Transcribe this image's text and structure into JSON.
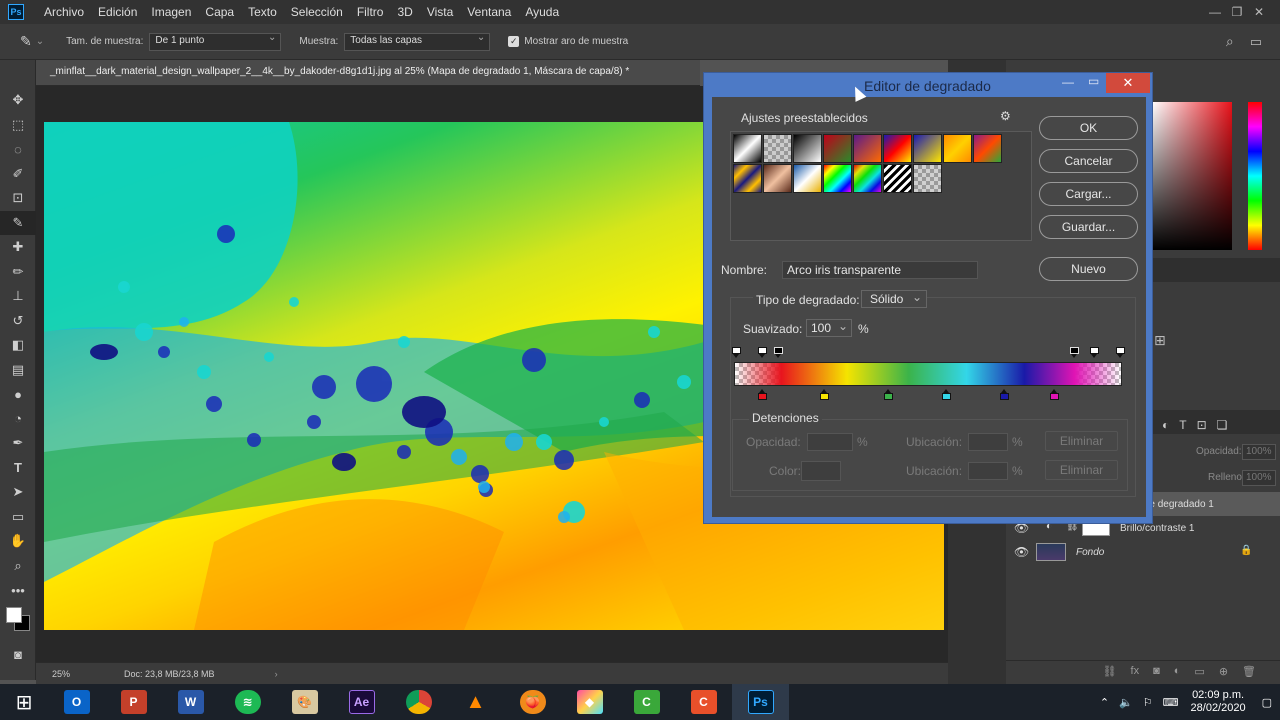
{
  "app": {
    "logo": "Ps"
  },
  "menu": [
    "Archivo",
    "Edición",
    "Imagen",
    "Capa",
    "Texto",
    "Selección",
    "Filtro",
    "3D",
    "Vista",
    "Ventana",
    "Ayuda"
  ],
  "options": {
    "sample_size_label": "Tam. de muestra:",
    "sample_size_value": "De 1 punto",
    "sample_label": "Muestra:",
    "sample_value": "Todas las capas",
    "show_ring_label": "Mostrar aro de muestra"
  },
  "document": {
    "tab_title": "_minflat__dark_material_design_wallpaper_2__4k__by_dakoder-d8g1d1j.jpg al 25% (Mapa de degradado 1, Máscara de capa/8) *",
    "close": "×",
    "zoom": "25%",
    "doc_info": "Doc: 23,8 MB/23,8 MB"
  },
  "dialog": {
    "title": "Editor de degradado",
    "presets_label": "Ajustes preestablecidos",
    "buttons": {
      "ok": "OK",
      "cancel": "Cancelar",
      "load": "Cargar...",
      "save": "Guardar...",
      "new": "Nuevo"
    },
    "name_label": "Nombre:",
    "name_value": "Arco iris transparente",
    "type_label": "Tipo de degradado:",
    "type_value": "Sólido",
    "smooth_label": "Suavizado:",
    "smooth_value": "100",
    "percent": "%",
    "stops_label": "Detenciones",
    "opacity_label": "Opacidad:",
    "location_label": "Ubicación:",
    "color_label": "Color:",
    "delete_label": "Eliminar",
    "color_stops": [
      "#e8141e",
      "#f5e400",
      "#3bb34a",
      "#33d6e8",
      "#1a1aa8",
      "#e014b4"
    ]
  },
  "layers": {
    "opacity_label": "Opacidad:",
    "opacity_value": "100%",
    "fill_label": "Relleno:",
    "fill_value": "100%",
    "items": [
      {
        "name": "Mapa de degradado 1"
      },
      {
        "name": "Brillo/contraste 1"
      },
      {
        "name": "Fondo"
      }
    ]
  },
  "taskbar": {
    "time": "02:09 p.m.",
    "date": "28/02/2020"
  }
}
